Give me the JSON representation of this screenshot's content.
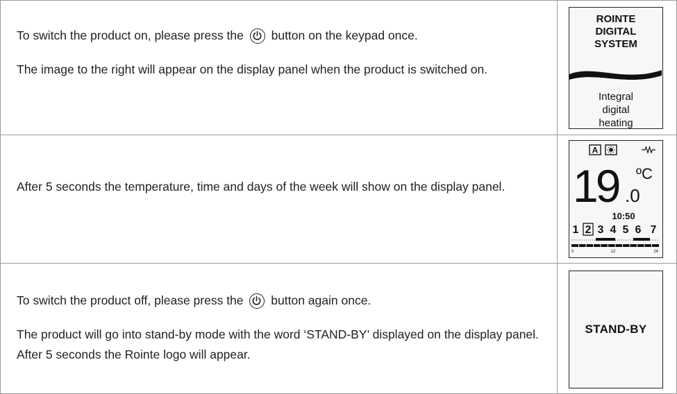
{
  "rows": [
    {
      "line1_before": "To switch the product on, please press the",
      "line1_after": "button on the keypad once.",
      "paragraph2": "The image to the right will appear on the display panel when the product is switched on.",
      "power_icon": "power-icon"
    },
    {
      "paragraph1": "After 5 seconds the temperature, time and days of the week will show on the display panel."
    },
    {
      "line1_before": "To switch the product off, please press the",
      "line1_after": "button again once.",
      "paragraph2": "The product will go into stand-by mode with the word ‘STAND-BY’ displayed on the display panel. After 5 seconds the Rointe logo will appear.",
      "power_icon": "power-icon"
    }
  ],
  "logo_panel": {
    "line1": "ROINTE",
    "line2": "DIGITAL",
    "line3": "SYSTEM",
    "sub1": "Integral",
    "sub2": "digital",
    "sub3": "heating"
  },
  "display_panel": {
    "mode_letter": "A",
    "mode_icon": "sun-icon",
    "resistor_icon": "resistor-icon",
    "temp_integer": "19",
    "temp_decimal": ".0",
    "unit": "ºC",
    "time": "10:50",
    "days": [
      "1",
      "2",
      "3",
      "4",
      "5",
      "6",
      "7"
    ],
    "selected_day": "2",
    "timeline_labels": [
      "0",
      "12",
      "24"
    ]
  },
  "standby_panel": {
    "label": "STAND-BY"
  }
}
